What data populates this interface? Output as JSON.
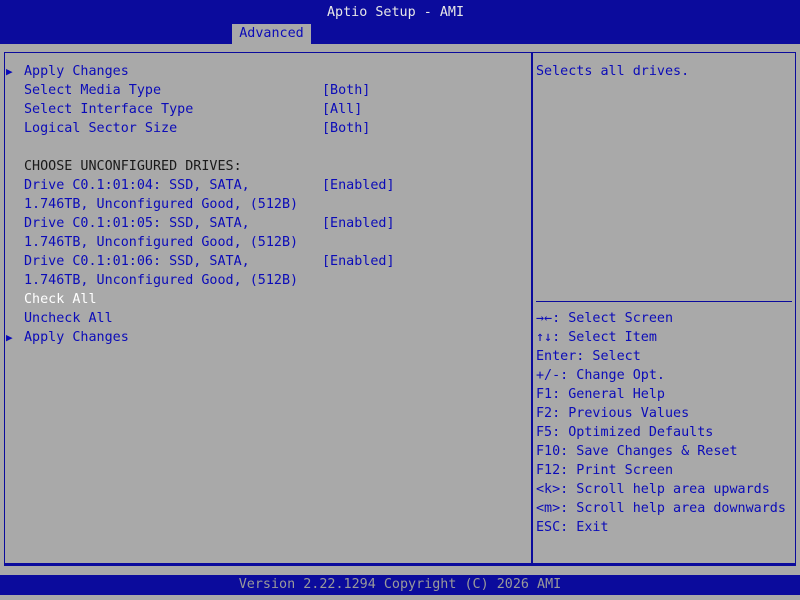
{
  "app": {
    "title": "Aptio Setup - AMI"
  },
  "tabs": [
    {
      "label": "Advanced"
    }
  ],
  "menu": {
    "apply_changes_top": "Apply Changes",
    "select_media_type": {
      "label": "Select Media Type",
      "value": "[Both]"
    },
    "select_interface_type": {
      "label": "Select Interface Type",
      "value": "[All]"
    },
    "logical_sector_size": {
      "label": "Logical Sector Size",
      "value": "[Both]"
    },
    "section_header": "CHOOSE UNCONFIGURED DRIVES:",
    "drives": [
      {
        "line1": "Drive C0.1:01:04: SSD, SATA,",
        "line2": "1.746TB, Unconfigured Good, (512B)",
        "value": "[Enabled]"
      },
      {
        "line1": "Drive C0.1:01:05: SSD, SATA,",
        "line2": "1.746TB, Unconfigured Good, (512B)",
        "value": "[Enabled]"
      },
      {
        "line1": "Drive C0.1:01:06: SSD, SATA,",
        "line2": "1.746TB, Unconfigured Good, (512B)",
        "value": "[Enabled]"
      }
    ],
    "check_all": "Check All",
    "uncheck_all": "Uncheck All",
    "apply_changes_bottom": "Apply Changes"
  },
  "help": {
    "description": "Selects all drives.",
    "keys": [
      "→←: Select Screen",
      "↑↓: Select Item",
      "Enter: Select",
      "+/-: Change Opt.",
      "F1: General Help",
      "F2: Previous Values",
      "F5: Optimized Defaults",
      "F10: Save Changes & Reset",
      "F12: Print Screen",
      "<k>: Scroll help area upwards",
      "<m>: Scroll help area downwards",
      "ESC: Exit"
    ]
  },
  "footer": {
    "version": "Version 2.22.1294 Copyright (C) 2026 AMI"
  },
  "colors": {
    "background": "#a9a9a9",
    "bar": "#0b0b9c",
    "item_text": "#0b0bb8",
    "selected_text": "#ffffff",
    "plain_text": "#1a1a1a"
  },
  "icons": {
    "submenu": "triangle-right-icon"
  }
}
